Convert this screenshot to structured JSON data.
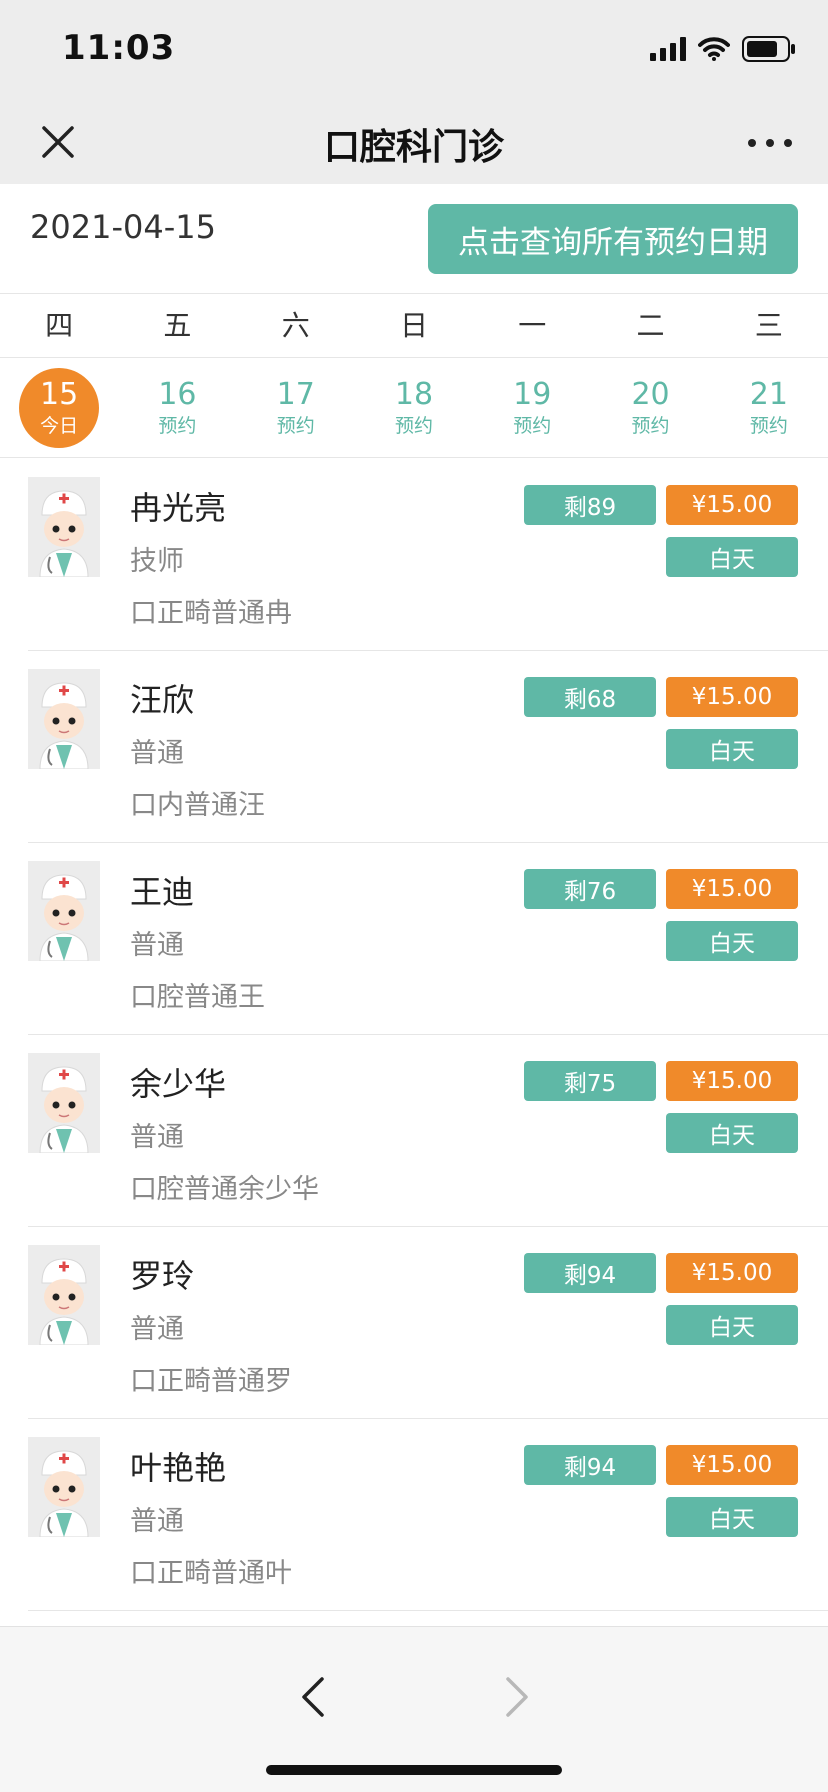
{
  "status_bar": {
    "time": "11:03"
  },
  "nav": {
    "title": "口腔科门诊"
  },
  "date_header": {
    "current_date": "2021-04-15",
    "query_button_label": "点击查询所有预约日期"
  },
  "week": {
    "weekdays": [
      "四",
      "五",
      "六",
      "日",
      "一",
      "二",
      "三"
    ],
    "dates": [
      {
        "day": "15",
        "sub": "今日",
        "selected": true
      },
      {
        "day": "16",
        "sub": "预约",
        "selected": false
      },
      {
        "day": "17",
        "sub": "预约",
        "selected": false
      },
      {
        "day": "18",
        "sub": "预约",
        "selected": false
      },
      {
        "day": "19",
        "sub": "预约",
        "selected": false
      },
      {
        "day": "20",
        "sub": "预约",
        "selected": false
      },
      {
        "day": "21",
        "sub": "预约",
        "selected": false
      }
    ]
  },
  "doctors": [
    {
      "name": "冉光亮",
      "title": "技师",
      "specialty": "口正畸普通冉",
      "remaining": "剩89",
      "price": "¥15.00",
      "period": "白天"
    },
    {
      "name": "汪欣",
      "title": "普通",
      "specialty": "口内普通汪",
      "remaining": "剩68",
      "price": "¥15.00",
      "period": "白天"
    },
    {
      "name": "王迪",
      "title": "普通",
      "specialty": "口腔普通王",
      "remaining": "剩76",
      "price": "¥15.00",
      "period": "白天"
    },
    {
      "name": "余少华",
      "title": "普通",
      "specialty": "口腔普通余少华",
      "remaining": "剩75",
      "price": "¥15.00",
      "period": "白天"
    },
    {
      "name": "罗玲",
      "title": "普通",
      "specialty": "口正畸普通罗",
      "remaining": "剩94",
      "price": "¥15.00",
      "period": "白天"
    },
    {
      "name": "叶艳艳",
      "title": "普通",
      "specialty": "口正畸普通叶",
      "remaining": "剩94",
      "price": "¥15.00",
      "period": "白天"
    }
  ],
  "icons": {
    "close": "close-icon",
    "more": "more-dots-icon",
    "back": "chevron-left-icon",
    "forward": "chevron-right-icon",
    "avatar": "doctor-avatar-icon"
  },
  "colors": {
    "accent_green": "#5fb8a6",
    "accent_orange": "#f08a2a",
    "nav_bg": "#ededed"
  }
}
